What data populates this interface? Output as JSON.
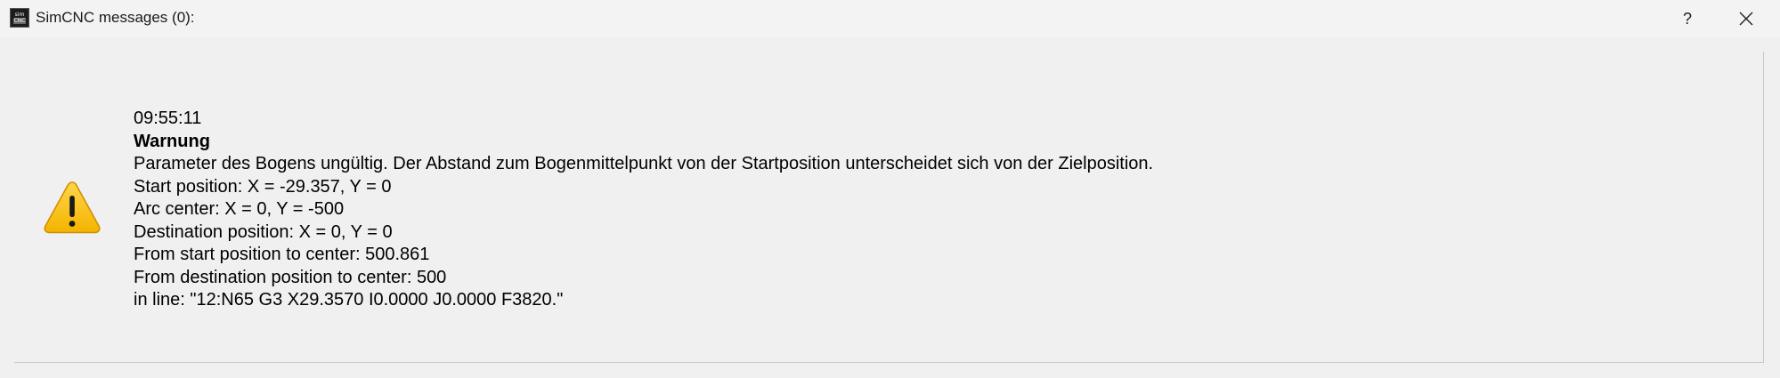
{
  "window": {
    "title": "SimCNC messages (0):",
    "help_label": "?",
    "icon_top_text": "sim",
    "icon_bottom_text": "CNC"
  },
  "message": {
    "icon": "warning-triangle-icon",
    "time": "09:55:11",
    "level": "Warnung",
    "description": "Parameter des Bogens ungültig. Der Abstand zum Bogenmittelpunkt von der Startposition unterscheidet sich von der Zielposition.",
    "start_position": "Start position: X = -29.357, Y = 0",
    "arc_center": "Arc center: X = 0, Y = -500",
    "destination_position": "Destination position: X = 0, Y = 0",
    "from_start_to_center": "From start position to center: 500.861",
    "from_destination_to_center": "From destination position to center: 500",
    "in_line": "in line: \"12:N65 G3 X29.3570 I0.0000 J0.0000 F3820.\""
  },
  "colors": {
    "warning_fill": "#f7c21b",
    "warning_border": "#d18a00",
    "background": "#f0f0f0"
  }
}
